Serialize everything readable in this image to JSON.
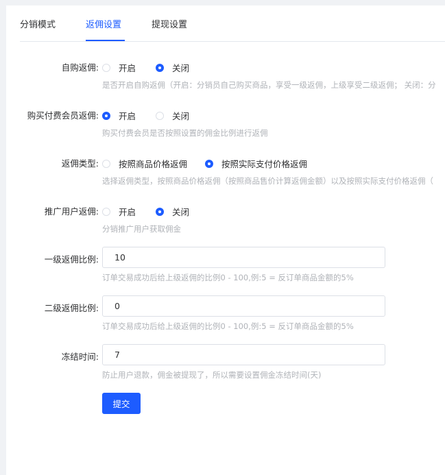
{
  "tabs": [
    {
      "label": "分销模式",
      "active": false
    },
    {
      "label": "返佣设置",
      "active": true
    },
    {
      "label": "提现设置",
      "active": false
    }
  ],
  "form": {
    "self_purchase": {
      "label": "自购返佣:",
      "options": [
        "开启",
        "关闭"
      ],
      "selected": "关闭",
      "help": "是否开启自购返佣（开启：分销员自己购买商品，享受一级返佣，上级享受二级返佣； 关闭：分"
    },
    "paid_member": {
      "label": "购买付费会员返佣:",
      "options": [
        "开启",
        "关闭"
      ],
      "selected": "开启",
      "help": "购买付费会员是否按照设置的佣金比例进行返佣"
    },
    "rebate_type": {
      "label": "返佣类型:",
      "options": [
        "按照商品价格返佣",
        "按照实际支付价格返佣"
      ],
      "selected": "按照实际支付价格返佣",
      "help": "选择返佣类型，按照商品价格返佣（按照商品售价计算返佣金额）以及按照实际支付价格返佣（"
    },
    "promote_user": {
      "label": "推广用户返佣:",
      "options": [
        "开启",
        "关闭"
      ],
      "selected": "关闭",
      "help": "分销推广用户获取佣金"
    },
    "level1_ratio": {
      "label": "一级返佣比例:",
      "value": "10",
      "help": "订单交易成功后给上级返佣的比例0 - 100,例:5 = 反订单商品金额的5%"
    },
    "level2_ratio": {
      "label": "二级返佣比例:",
      "value": "0",
      "help": "订单交易成功后给上级返佣的比例0 - 100,例:5 = 反订单商品金额的5%"
    },
    "freeze_time": {
      "label": "冻结时间:",
      "value": "7",
      "help": "防止用户退款，佣金被提现了，所以需要设置佣金冻结时间(天)"
    },
    "submit_label": "提交"
  },
  "colors": {
    "primary": "#1d5cff",
    "help_text": "#b0b3b8",
    "border": "#dcdfe6"
  }
}
